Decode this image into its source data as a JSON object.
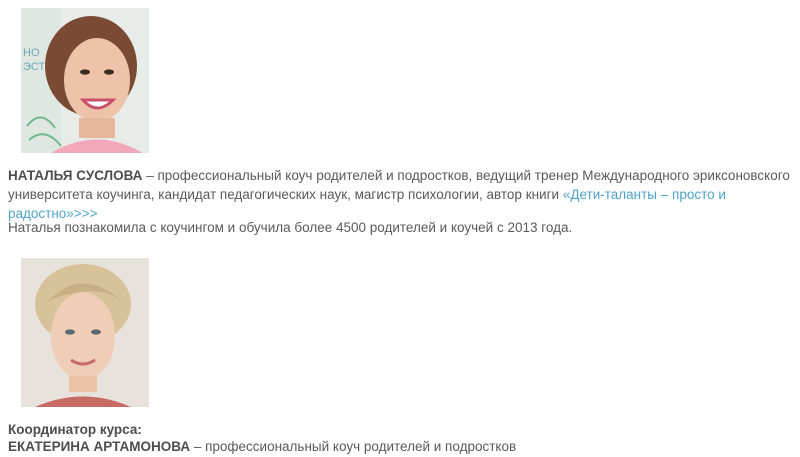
{
  "person1": {
    "name": "НАТАЛЬЯ СУСЛОВА",
    "description": " – профессиональный коуч родителей и подростков, ведущий тренер Международного эриксоновского университета коучинга, кандидат педагогических наук, магистр психологии, автор книги ",
    "book_link": "«Дети-таланты – просто и радостно»>>>",
    "experience": "Наталья познакомила с коучингом и обучила более 4500 родителей и коучей  с 2013 года."
  },
  "person2": {
    "role_label": "Координатор курса:",
    "name": "ЕКАТЕРИНА АРТАМОНОВА",
    "description": " – профессиональный коуч родителей и подростков"
  },
  "colors": {
    "text": "#5a5a5a",
    "link": "#4fa3c8"
  }
}
